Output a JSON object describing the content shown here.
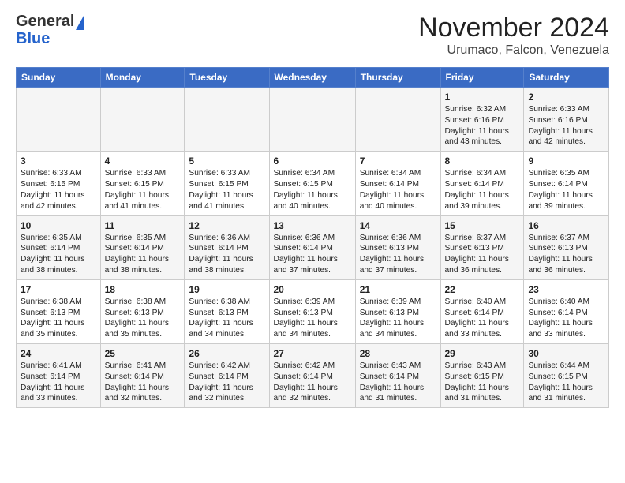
{
  "header": {
    "logo_line1": "General",
    "logo_line2": "Blue",
    "title": "November 2024",
    "subtitle": "Urumaco, Falcon, Venezuela"
  },
  "days_of_week": [
    "Sunday",
    "Monday",
    "Tuesday",
    "Wednesday",
    "Thursday",
    "Friday",
    "Saturday"
  ],
  "weeks": [
    [
      {
        "day": "",
        "text": ""
      },
      {
        "day": "",
        "text": ""
      },
      {
        "day": "",
        "text": ""
      },
      {
        "day": "",
        "text": ""
      },
      {
        "day": "",
        "text": ""
      },
      {
        "day": "1",
        "text": "Sunrise: 6:32 AM\nSunset: 6:16 PM\nDaylight: 11 hours\nand 43 minutes."
      },
      {
        "day": "2",
        "text": "Sunrise: 6:33 AM\nSunset: 6:16 PM\nDaylight: 11 hours\nand 42 minutes."
      }
    ],
    [
      {
        "day": "3",
        "text": "Sunrise: 6:33 AM\nSunset: 6:15 PM\nDaylight: 11 hours\nand 42 minutes."
      },
      {
        "day": "4",
        "text": "Sunrise: 6:33 AM\nSunset: 6:15 PM\nDaylight: 11 hours\nand 41 minutes."
      },
      {
        "day": "5",
        "text": "Sunrise: 6:33 AM\nSunset: 6:15 PM\nDaylight: 11 hours\nand 41 minutes."
      },
      {
        "day": "6",
        "text": "Sunrise: 6:34 AM\nSunset: 6:15 PM\nDaylight: 11 hours\nand 40 minutes."
      },
      {
        "day": "7",
        "text": "Sunrise: 6:34 AM\nSunset: 6:14 PM\nDaylight: 11 hours\nand 40 minutes."
      },
      {
        "day": "8",
        "text": "Sunrise: 6:34 AM\nSunset: 6:14 PM\nDaylight: 11 hours\nand 39 minutes."
      },
      {
        "day": "9",
        "text": "Sunrise: 6:35 AM\nSunset: 6:14 PM\nDaylight: 11 hours\nand 39 minutes."
      }
    ],
    [
      {
        "day": "10",
        "text": "Sunrise: 6:35 AM\nSunset: 6:14 PM\nDaylight: 11 hours\nand 38 minutes."
      },
      {
        "day": "11",
        "text": "Sunrise: 6:35 AM\nSunset: 6:14 PM\nDaylight: 11 hours\nand 38 minutes."
      },
      {
        "day": "12",
        "text": "Sunrise: 6:36 AM\nSunset: 6:14 PM\nDaylight: 11 hours\nand 38 minutes."
      },
      {
        "day": "13",
        "text": "Sunrise: 6:36 AM\nSunset: 6:14 PM\nDaylight: 11 hours\nand 37 minutes."
      },
      {
        "day": "14",
        "text": "Sunrise: 6:36 AM\nSunset: 6:13 PM\nDaylight: 11 hours\nand 37 minutes."
      },
      {
        "day": "15",
        "text": "Sunrise: 6:37 AM\nSunset: 6:13 PM\nDaylight: 11 hours\nand 36 minutes."
      },
      {
        "day": "16",
        "text": "Sunrise: 6:37 AM\nSunset: 6:13 PM\nDaylight: 11 hours\nand 36 minutes."
      }
    ],
    [
      {
        "day": "17",
        "text": "Sunrise: 6:38 AM\nSunset: 6:13 PM\nDaylight: 11 hours\nand 35 minutes."
      },
      {
        "day": "18",
        "text": "Sunrise: 6:38 AM\nSunset: 6:13 PM\nDaylight: 11 hours\nand 35 minutes."
      },
      {
        "day": "19",
        "text": "Sunrise: 6:38 AM\nSunset: 6:13 PM\nDaylight: 11 hours\nand 34 minutes."
      },
      {
        "day": "20",
        "text": "Sunrise: 6:39 AM\nSunset: 6:13 PM\nDaylight: 11 hours\nand 34 minutes."
      },
      {
        "day": "21",
        "text": "Sunrise: 6:39 AM\nSunset: 6:13 PM\nDaylight: 11 hours\nand 34 minutes."
      },
      {
        "day": "22",
        "text": "Sunrise: 6:40 AM\nSunset: 6:14 PM\nDaylight: 11 hours\nand 33 minutes."
      },
      {
        "day": "23",
        "text": "Sunrise: 6:40 AM\nSunset: 6:14 PM\nDaylight: 11 hours\nand 33 minutes."
      }
    ],
    [
      {
        "day": "24",
        "text": "Sunrise: 6:41 AM\nSunset: 6:14 PM\nDaylight: 11 hours\nand 33 minutes."
      },
      {
        "day": "25",
        "text": "Sunrise: 6:41 AM\nSunset: 6:14 PM\nDaylight: 11 hours\nand 32 minutes."
      },
      {
        "day": "26",
        "text": "Sunrise: 6:42 AM\nSunset: 6:14 PM\nDaylight: 11 hours\nand 32 minutes."
      },
      {
        "day": "27",
        "text": "Sunrise: 6:42 AM\nSunset: 6:14 PM\nDaylight: 11 hours\nand 32 minutes."
      },
      {
        "day": "28",
        "text": "Sunrise: 6:43 AM\nSunset: 6:14 PM\nDaylight: 11 hours\nand 31 minutes."
      },
      {
        "day": "29",
        "text": "Sunrise: 6:43 AM\nSunset: 6:15 PM\nDaylight: 11 hours\nand 31 minutes."
      },
      {
        "day": "30",
        "text": "Sunrise: 6:44 AM\nSunset: 6:15 PM\nDaylight: 11 hours\nand 31 minutes."
      }
    ]
  ]
}
